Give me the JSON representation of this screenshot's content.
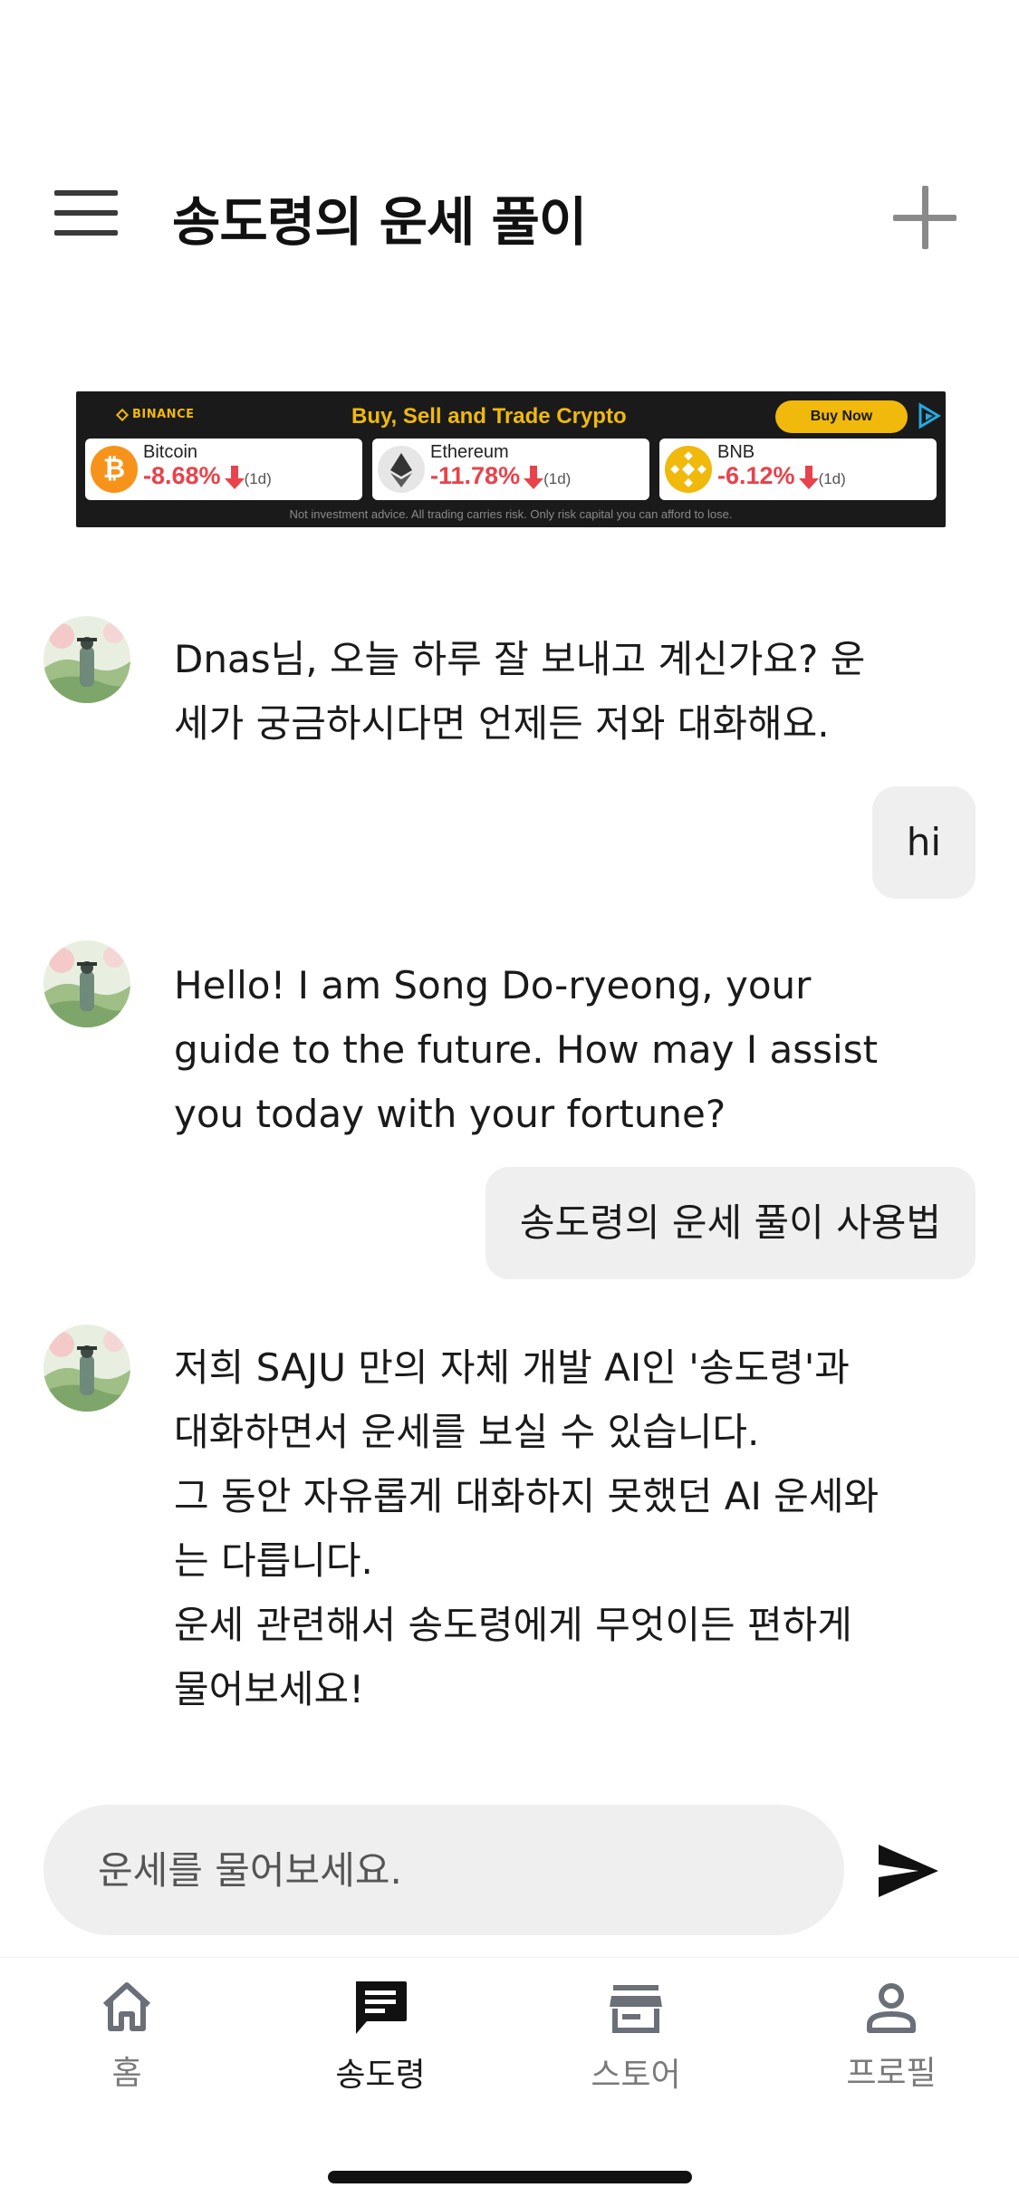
{
  "header": {
    "title": "송도령의 운세 풀이"
  },
  "ad": {
    "brand": "BINANCE",
    "headline": "Buy, Sell and Trade Crypto",
    "cta": "Buy Now",
    "coins": [
      {
        "name": "Bitcoin",
        "change": "-8.68%",
        "period": "(1d)",
        "symbol": "₿",
        "color": "#f7931a"
      },
      {
        "name": "Ethereum",
        "change": "-11.78%",
        "period": "(1d)",
        "symbol": "◆",
        "color": "#e6e6e6"
      },
      {
        "name": "BNB",
        "change": "-6.12%",
        "period": "(1d)",
        "symbol": "◈",
        "color": "#f0b90b"
      }
    ],
    "disclaimer": "Not investment advice. All trading carries risk. Only risk capital you can afford to lose."
  },
  "chat": {
    "messages": [
      {
        "sender": "bot",
        "text": "Dnas님, 오늘 하루 잘 보내고 계신가요? 운\n세가 궁금하시다면 언제든 저와 대화해요."
      },
      {
        "sender": "user",
        "text": "hi"
      },
      {
        "sender": "bot",
        "text": "Hello! I am Song Do-ryeong, your\nguide to the future. How may I assist\nyou today with your fortune?"
      },
      {
        "sender": "user",
        "text": "송도령의 운세 풀이 사용법"
      },
      {
        "sender": "bot",
        "text": "저희 SAJU 만의 자체 개발 AI인 '송도령'과\n대화하면서 운세를 보실 수 있습니다.\n그 동안 자유롭게 대화하지 못했던 AI 운세와\n는 다릅니다.\n운세 관련해서 송도령에게 무엇이든 편하게\n물어보세요!"
      }
    ]
  },
  "input": {
    "placeholder": "운세를 물어보세요."
  },
  "tabs": [
    {
      "label": "홈",
      "icon": "home-icon",
      "active": false
    },
    {
      "label": "송도령",
      "icon": "chat-icon",
      "active": true
    },
    {
      "label": "스토어",
      "icon": "store-icon",
      "active": false
    },
    {
      "label": "프로필",
      "icon": "profile-icon",
      "active": false
    }
  ]
}
